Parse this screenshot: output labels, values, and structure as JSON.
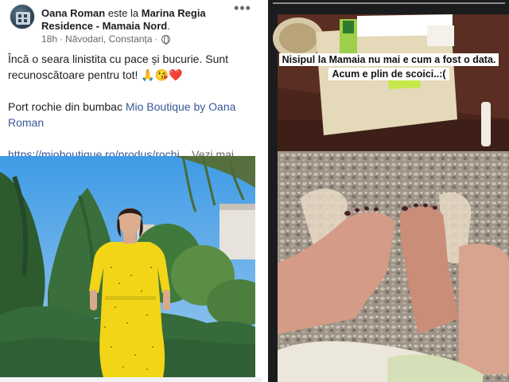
{
  "post": {
    "author": "Oana Roman",
    "verb": "este la",
    "place": "Marina Regia Residence - Mamaia Nord",
    "place_suffix": ".",
    "time": "18h",
    "separator": "·",
    "location": "Năvodari, Constanța",
    "text_line": "Încă o seara linistita cu pace și bucurie. Sunt recunoscătoare pentru tot! 🙏😘❤️",
    "product_prefix": "Port rochie din bumbac",
    "product_link": "Mio Boutique by Oana Roman",
    "url": "https://mioboutique.ro/produs/rochi...",
    "see_more": "Vezi mai mult"
  },
  "story": {
    "caption_line1": "Nisipul la Mamaia nu mai e cum a fost o data.",
    "caption_line2": "Acum e plin de scoici..:("
  },
  "colors": {
    "link": "#385898",
    "secondary_text": "#65676b",
    "dress": "#f2d516",
    "caption_bg": "#ffffff"
  },
  "icons": {
    "more": "more-options-icon",
    "globe": "globe-icon",
    "avatar": "page-avatar"
  }
}
